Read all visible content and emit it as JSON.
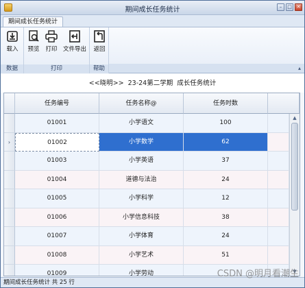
{
  "window": {
    "title": "期间成长任务统计"
  },
  "ribbon": {
    "tab_label": "期间成长任务统计",
    "groups": [
      {
        "label": "数据",
        "buttons": [
          {
            "label": "载入",
            "icon": "import-icon"
          }
        ]
      },
      {
        "label": "打印",
        "buttons": [
          {
            "label": "预览",
            "icon": "preview-icon"
          },
          {
            "label": "打印",
            "icon": "printer-icon"
          },
          {
            "label": "文件导出",
            "icon": "export-icon"
          }
        ]
      },
      {
        "label": "帮助",
        "buttons": [
          {
            "label": "返回",
            "icon": "return-icon"
          }
        ]
      }
    ]
  },
  "report": {
    "header": "<<晓明>>  23-24第二学期  成长任务统计"
  },
  "table": {
    "columns": [
      "任务编号",
      "任务名称@",
      "任务时数"
    ],
    "rows": [
      [
        "01001",
        "小学语文",
        "100"
      ],
      [
        "01002",
        "小学数学",
        "62"
      ],
      [
        "01003",
        "小学英语",
        "37"
      ],
      [
        "01004",
        "道德与法治",
        "24"
      ],
      [
        "01005",
        "小学科学",
        "12"
      ],
      [
        "01006",
        "小学信息科技",
        "38"
      ],
      [
        "01007",
        "小学体育",
        "24"
      ],
      [
        "01008",
        "小学艺术",
        "51"
      ],
      [
        "01009",
        "小学劳动",
        ""
      ]
    ],
    "current_row_marker": "›",
    "current_row_index": 1
  },
  "status": {
    "text": "期间成长任务统计 共 25 行"
  },
  "watermark": "CSDN @明月看潮生",
  "colors": {
    "selected": "#2f6fcf",
    "even_row": "#eef4fc",
    "odd_row": "#faf3f6"
  }
}
